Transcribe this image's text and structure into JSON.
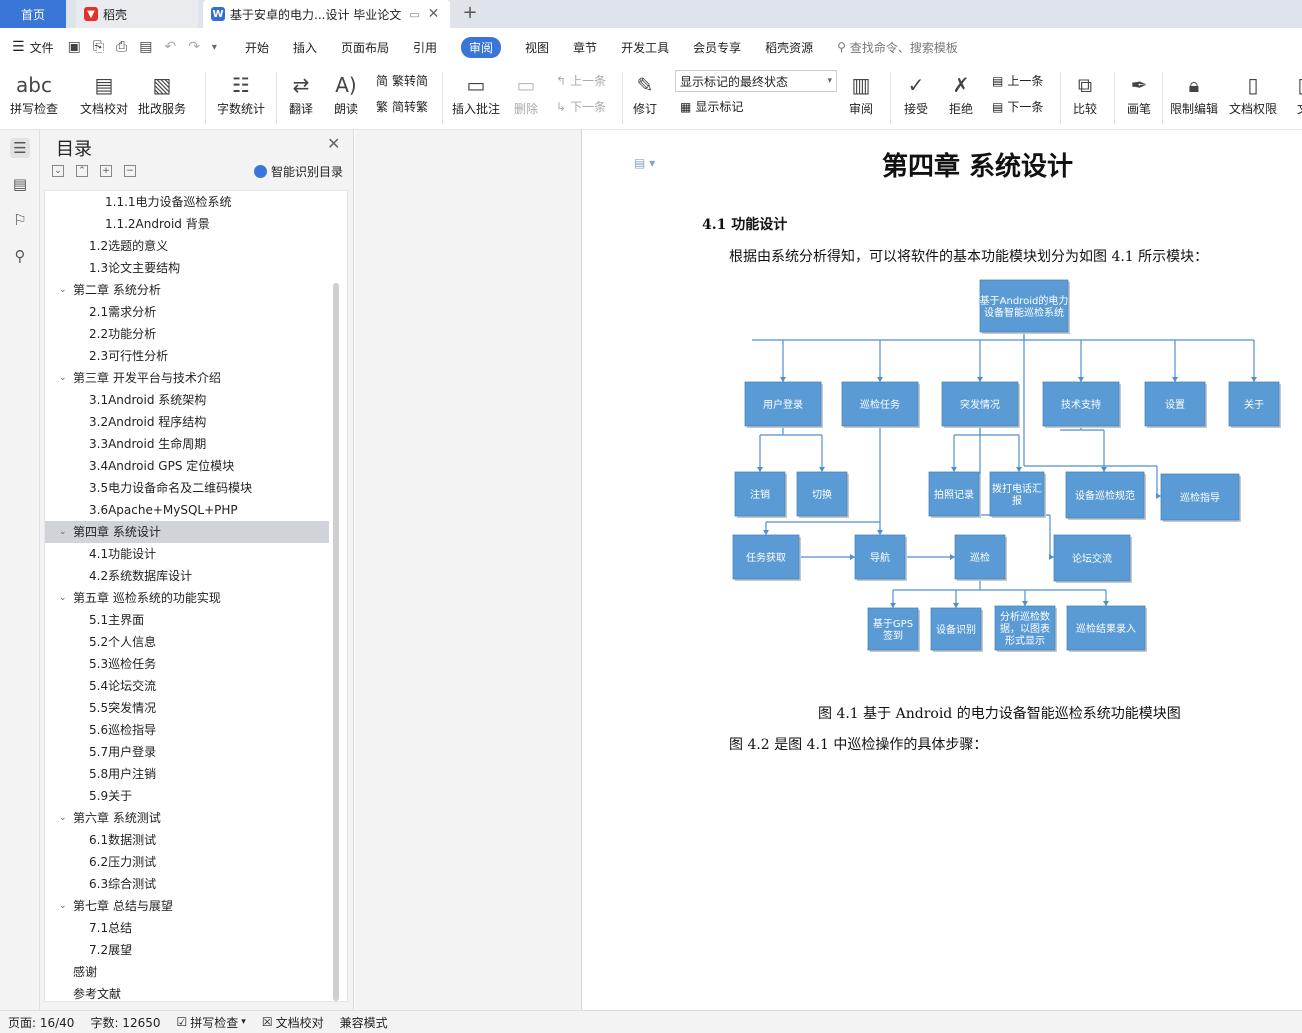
{
  "tabs": {
    "home": "首页",
    "daoke": "稻壳",
    "doc": "基于安卓的电力...设计 毕业论文"
  },
  "menu": {
    "file": "文件",
    "items": [
      "开始",
      "插入",
      "页面布局",
      "引用",
      "审阅",
      "视图",
      "章节",
      "开发工具",
      "会员专享",
      "稻壳资源"
    ],
    "search": "查找命令、搜索模板"
  },
  "ribbon": {
    "spell": "拼写检查",
    "proof": "文档校对",
    "batch": "批改服务",
    "wordcount": "字数统计",
    "translate": "翻译",
    "read": "朗读",
    "to_trad": "繁转简",
    "to_simp": "简转繁",
    "insert_comment": "插入批注",
    "delete": "删除",
    "prev": "上一条",
    "next": "下一条",
    "revise": "修订",
    "markup_state": "显示标记的最终状态",
    "show_markup": "显示标记",
    "review": "审阅",
    "accept": "接受",
    "reject": "拒绝",
    "prev2": "上一条",
    "next2": "下一条",
    "compare": "比较",
    "pen": "画笔",
    "restrict": "限制编辑",
    "rights": "文档权限",
    "more": "文"
  },
  "toc": {
    "title": "目录",
    "smart": "智能识别目录",
    "items": [
      {
        "text": "1.1.1电力设备巡检系统",
        "level": 3
      },
      {
        "text": "1.1.2Android 背景",
        "level": 3
      },
      {
        "text": "1.2选题的意义",
        "level": 2
      },
      {
        "text": "1.3论文主要结构",
        "level": 2
      },
      {
        "text": "第二章  系统分析",
        "level": 1
      },
      {
        "text": "2.1需求分析",
        "level": 2
      },
      {
        "text": "2.2功能分析",
        "level": 2
      },
      {
        "text": "2.3可行性分析",
        "level": 2
      },
      {
        "text": "第三章  开发平台与技术介绍",
        "level": 1
      },
      {
        "text": "3.1Android 系统架构",
        "level": 2
      },
      {
        "text": "3.2Android 程序结构",
        "level": 2
      },
      {
        "text": "3.3Android 生命周期",
        "level": 2
      },
      {
        "text": "3.4Android GPS 定位模块",
        "level": 2
      },
      {
        "text": "3.5电力设备命名及二维码模块",
        "level": 2
      },
      {
        "text": "3.6Apache+MySQL+PHP",
        "level": 2
      },
      {
        "text": "第四章  系统设计",
        "level": 1,
        "selected": true
      },
      {
        "text": "4.1功能设计",
        "level": 2
      },
      {
        "text": "4.2系统数据库设计",
        "level": 2
      },
      {
        "text": "第五章  巡检系统的功能实现",
        "level": 1
      },
      {
        "text": "5.1主界面",
        "level": 2
      },
      {
        "text": "5.2个人信息",
        "level": 2
      },
      {
        "text": "5.3巡检任务",
        "level": 2
      },
      {
        "text": "5.4论坛交流",
        "level": 2
      },
      {
        "text": "5.5突发情况",
        "level": 2
      },
      {
        "text": "5.6巡检指导",
        "level": 2
      },
      {
        "text": "5.7用户登录",
        "level": 2
      },
      {
        "text": "5.8用户注销",
        "level": 2
      },
      {
        "text": "5.9关于",
        "level": 2
      },
      {
        "text": "第六章  系统测试",
        "level": 1
      },
      {
        "text": "6.1数据测试",
        "level": 2
      },
      {
        "text": "6.2压力测试",
        "level": 2
      },
      {
        "text": "6.3综合测试",
        "level": 2
      },
      {
        "text": "第七章  总结与展望",
        "level": 1
      },
      {
        "text": "7.1总结",
        "level": 2
      },
      {
        "text": "7.2展望",
        "level": 2
      },
      {
        "text": "感谢",
        "level": 0
      },
      {
        "text": "参考文献",
        "level": 0
      }
    ]
  },
  "doc": {
    "chapter_title": "第四章  系统设计",
    "section": "4.1 功能设计",
    "intro": "根据由系统分析得知，可以将软件的基本功能模块划分为如图 4.1 所示模块：",
    "caption": "图  4.1  基于 Android 的电力设备智能巡检系统功能模块图",
    "next_para": "图 4.2 是图 4.1 中巡检操作的具体步骤：",
    "flow": {
      "root": "基于Android的电力|设备智能巡检系统",
      "user_login": "用户登录",
      "patrol_task": "巡检任务",
      "emergency": "突发情况",
      "tech_support": "技术支持",
      "settings": "设置",
      "about": "关于",
      "logout": "注销",
      "switch": "切换",
      "photo": "拍照记录",
      "call": "拨打电话汇|报",
      "norm": "设备巡检规范",
      "guide": "巡检指导",
      "get_task": "任务获取",
      "navigate": "导航",
      "patrol": "巡检",
      "forum": "论坛交流",
      "gps": "基于GPS|签到",
      "device_id": "设备识别",
      "analyze": "分析巡检数|据，以图表|形式显示",
      "result": "巡检结果录入"
    },
    "node_color": "#5b9bd5",
    "line_color": "#4f8fd0"
  },
  "status": {
    "page": "页面: 16/40",
    "words": "字数: 12650",
    "spell": "拼写检查",
    "proof": "文档校对",
    "compat": "兼容模式"
  }
}
